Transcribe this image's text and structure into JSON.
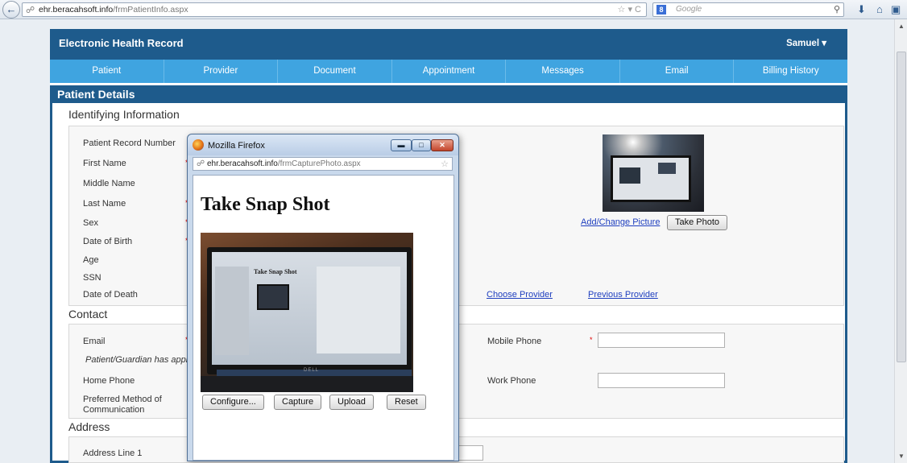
{
  "browser": {
    "url_domain": "ehr.beracahsoft.info",
    "url_path": "/frmPatientInfo.aspx",
    "search_placeholder": "Google",
    "search_engine_glyph": "8"
  },
  "app": {
    "title": "Electronic Health Record",
    "user": "Samuel",
    "nav": [
      "Patient",
      "Provider",
      "Document",
      "Appointment",
      "Messages",
      "Email",
      "Billing History"
    ]
  },
  "patient": {
    "section_title": "Patient Details",
    "identifying": {
      "title": "Identifying Information",
      "labels": {
        "record_number": "Patient Record Number",
        "first_name": "First Name",
        "middle_name": "Middle Name",
        "last_name": "Last Name",
        "sex": "Sex",
        "dob": "Date of Birth",
        "age": "Age",
        "ssn": "SSN",
        "dod": "Date of Death"
      },
      "add_change_picture": "Add/Change Picture",
      "take_photo": "Take Photo",
      "choose_provider": "Choose Provider",
      "previous_provider": "Previous Provider"
    },
    "contact": {
      "title": "Contact",
      "email": "Email",
      "guardian_note": "Patient/Guardian has appr",
      "home_phone": "Home Phone",
      "preferred_method": "Preferred Method of",
      "preferred_method_2": "Communication",
      "mobile_phone": "Mobile Phone",
      "work_phone": "Work Phone"
    },
    "address": {
      "title": "Address",
      "line1": "Address Line 1"
    },
    "required_marker": "*"
  },
  "popup": {
    "window_title": "Mozilla Firefox",
    "url_domain": "ehr.beracahsoft.info",
    "url_path": "/frmCapturePhoto.aspx",
    "heading": "Take Snap Shot",
    "buttons": {
      "configure": "Configure...",
      "capture": "Capture",
      "upload": "Upload",
      "reset": "Reset"
    }
  },
  "colors": {
    "header": "#1e5b8c",
    "nav": "#3fa4e0",
    "link": "#1f3fbf",
    "required": "#dd0000"
  }
}
